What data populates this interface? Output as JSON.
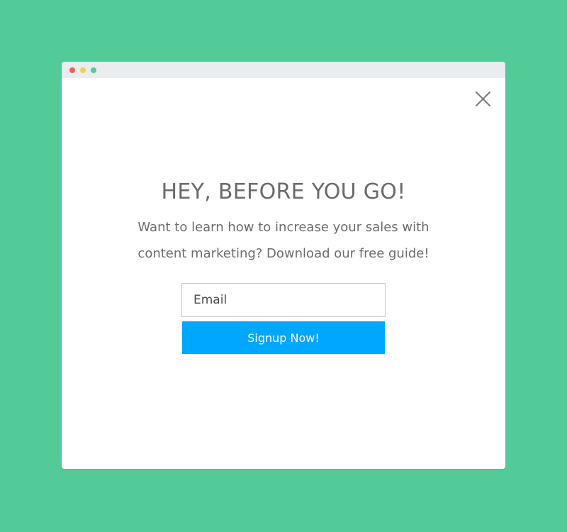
{
  "popup": {
    "window_controls": [
      "close-dot",
      "minimize-dot",
      "maximize-dot"
    ],
    "close_icon": "close-icon",
    "headline": "HEY, BEFORE YOU GO!",
    "subtext": "Want to learn how to increase your sales with content marketing? Download our free guide!",
    "email": {
      "value": "",
      "placeholder": "Email"
    },
    "signup_label": "Signup Now!"
  },
  "colors": {
    "background": "#52cb98",
    "button": "#00a7ff",
    "dot_red": "#f45a5a",
    "dot_yellow": "#f3d33a",
    "dot_green": "#52cb98"
  }
}
